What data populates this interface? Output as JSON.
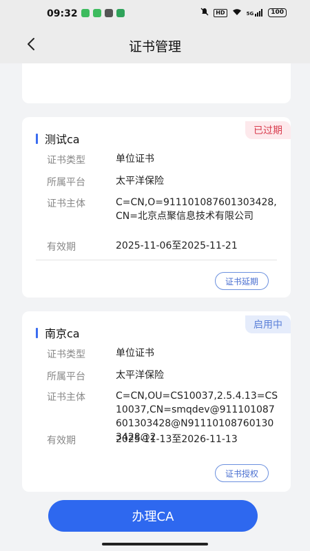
{
  "status_bar": {
    "time": "09:32",
    "hd": "HD",
    "signal": "5G",
    "battery": "100"
  },
  "header": {
    "title": "证书管理"
  },
  "labels": {
    "type": "证书类型",
    "platform": "所属平台",
    "subject": "证书主体",
    "validity": "有效期"
  },
  "certificates": [
    {
      "name": "测试ca",
      "status": "已过期",
      "type": "单位证书",
      "platform": "太平洋保险",
      "subject": "C=CN,O=911101087601303428,CN=北京点聚信息技术有限公司",
      "validity": "2025-11-06至2025-11-21",
      "action": "证书延期"
    },
    {
      "name": "南京ca",
      "status": "启用中",
      "type": "单位证书",
      "platform": "太平洋保险",
      "subject": "C=CN,OU=CS10037,2.5.4.13=CS10037,CN=smqdev@911101087601303428@N911101087601303428@2",
      "validity": "2025-11-13至2026-11-13",
      "action": "证书授权"
    }
  ],
  "bottom": {
    "apply_label": "办理CA"
  },
  "colors": {
    "accent": "#2e68ef",
    "expired": "#d83a4c",
    "active": "#5a7fd8"
  }
}
